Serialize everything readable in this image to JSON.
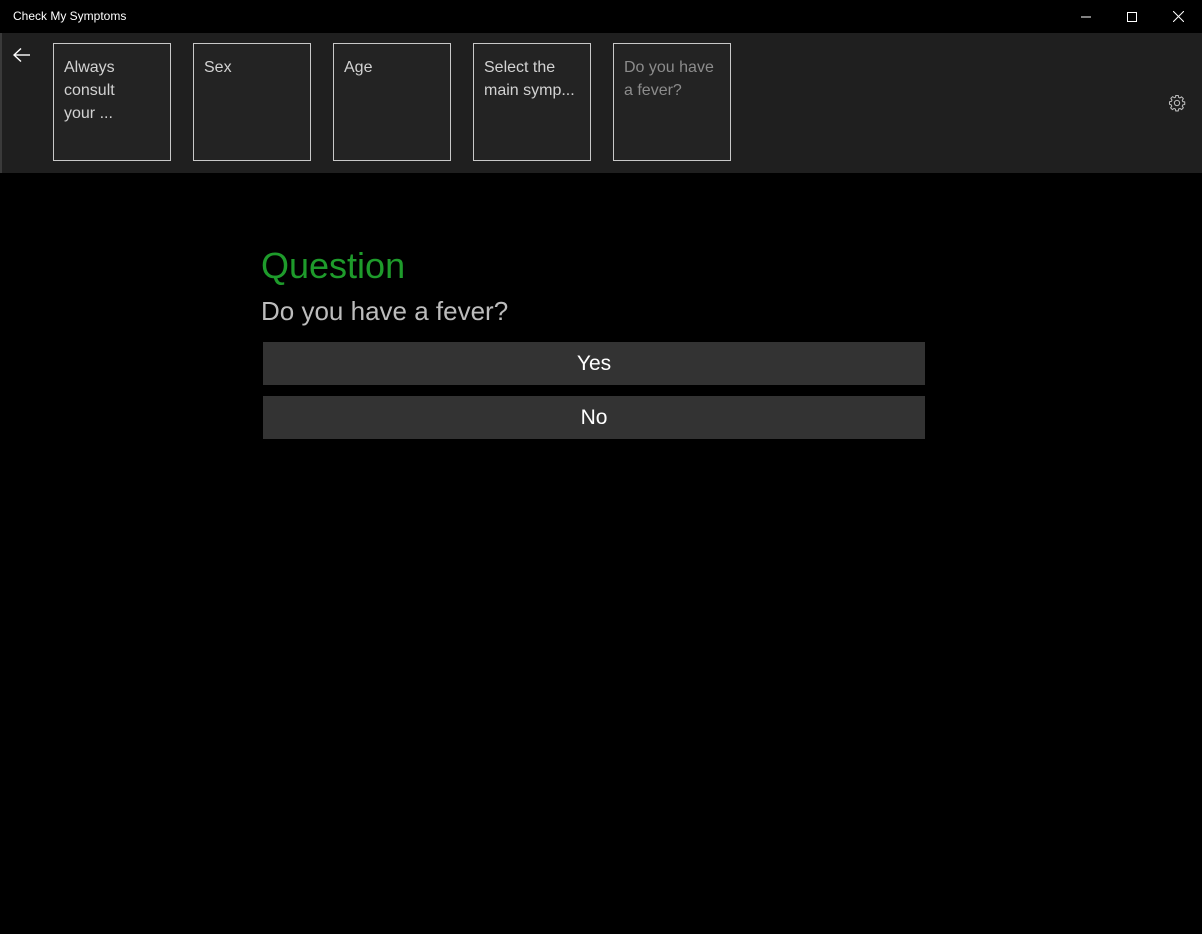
{
  "window": {
    "title": "Check My Symptoms"
  },
  "header": {
    "breadcrumbs": [
      {
        "label": "Always\nconsult\nyour ..."
      },
      {
        "label": "Sex"
      },
      {
        "label": "Age"
      },
      {
        "label": "Select the\nmain symp..."
      },
      {
        "label": "Do you have\na fever?"
      }
    ]
  },
  "main": {
    "heading": "Question",
    "question": "Do you have a fever?",
    "answers": [
      {
        "label": "Yes"
      },
      {
        "label": "No"
      }
    ]
  },
  "colors": {
    "accent": "#1e9b2b",
    "header_bg": "#1f1f1f",
    "button_bg": "#333333",
    "page_bg": "#000000"
  },
  "icons": {
    "back": "back-arrow-icon",
    "settings": "gear-icon",
    "minimize": "minimize-icon",
    "maximize": "maximize-icon",
    "close": "close-icon"
  }
}
